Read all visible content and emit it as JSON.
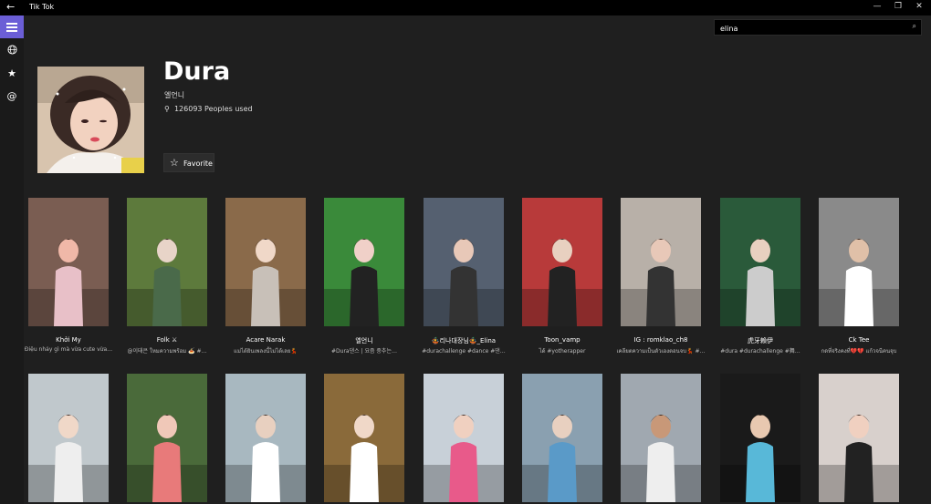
{
  "window": {
    "title": "Tik Tok",
    "back_icon": "←",
    "minimize": "—",
    "restore": "❐",
    "close": "✕"
  },
  "search": {
    "value": "elina",
    "icon": "⌕"
  },
  "sidebar": {
    "icons": [
      "hamburger-menu-icon",
      "globe-icon",
      "star-icon",
      "at-icon"
    ]
  },
  "profile": {
    "name": "Dura",
    "subtitle": "엘언니",
    "people_icon": "⚲",
    "people_used": "126093 Peoples used",
    "favorite_label": "Favorite",
    "favorite_icon": "☆"
  },
  "videos": [
    {
      "title": "Khởi My",
      "desc": "Điệu nhảy gì mà vừa cute vừa…"
    },
    {
      "title": "Folk ⚔",
      "desc": "@이태은 ใหมความพร้อม 🍝 #…"
    },
    {
      "title": "Acare Narak",
      "desc": "แม่ได้ยินเพลงนี้ไม่ได้เลย💃"
    },
    {
      "title": "엘언니",
      "desc": "#Dura댄스 | 요즘 중추는…"
    },
    {
      "title": "🤹리나대장님🤹_Elina",
      "desc": "#durachallenge #dance #댄…"
    },
    {
      "title": "Toon_vamp",
      "desc": "ได้ #yotherapper"
    },
    {
      "title": "IG : romklao_ch8",
      "desc": "เคลียตความเป็นตัวเองตอนจบ💃 #…"
    },
    {
      "title": "虎牙賴伊",
      "desc": "#dura #durachallenge #舞…"
    },
    {
      "title": "Ck Tee",
      "desc": "กดที่จริงคงที่💔💔 แก้วจนีคนจุบ"
    },
    {
      "title": "",
      "desc": ""
    },
    {
      "title": "",
      "desc": ""
    },
    {
      "title": "",
      "desc": ""
    },
    {
      "title": "",
      "desc": ""
    },
    {
      "title": "",
      "desc": ""
    },
    {
      "title": "",
      "desc": ""
    },
    {
      "title": "",
      "desc": ""
    },
    {
      "title": "",
      "desc": ""
    },
    {
      "title": "",
      "desc": ""
    }
  ]
}
